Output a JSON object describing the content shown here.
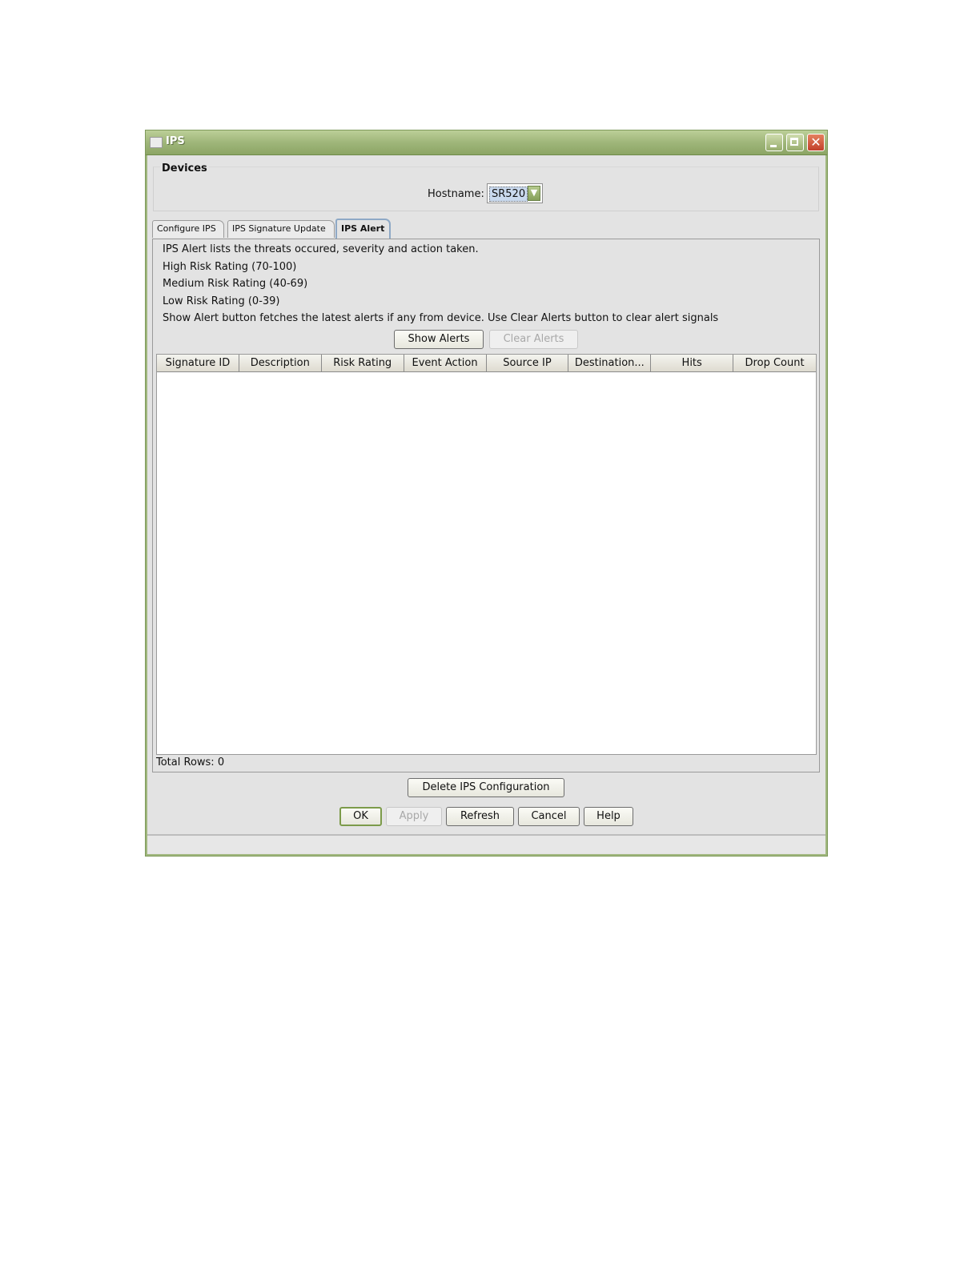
{
  "window": {
    "title": "IPS"
  },
  "devices": {
    "legend": "Devices",
    "hostname_label": "Hostname:",
    "hostname_value": "SR520"
  },
  "tabs": [
    {
      "label": "Configure IPS",
      "active": false
    },
    {
      "label": "IPS Signature Update",
      "active": false
    },
    {
      "label": "IPS Alert",
      "active": true
    }
  ],
  "alert": {
    "info_lines": [
      "IPS Alert lists the threats occured, severity and action taken.",
      "High Risk Rating (70-100)",
      "Medium Risk Rating (40-69)",
      "Low Risk Rating (0-39)",
      "Show Alert button fetches the latest alerts if any from device. Use Clear Alerts button to clear alert signals"
    ],
    "show_alerts_label": "Show Alerts",
    "clear_alerts_label": "Clear Alerts",
    "columns": [
      "Signature ID",
      "Description",
      "Risk Rating",
      "Event Action",
      "Source IP",
      "Destination...",
      "Hits",
      "Drop Count"
    ],
    "rows": [],
    "total_rows": "Total Rows: 0"
  },
  "buttons": {
    "delete_config": "Delete IPS Configuration",
    "ok": "OK",
    "apply": "Apply",
    "refresh": "Refresh",
    "cancel": "Cancel",
    "help": "Help"
  },
  "icons": {
    "window": "window-icon",
    "minimize": "minimize-icon",
    "maximize": "maximize-icon",
    "close": "close-icon",
    "dropdown": "chevron-down-icon"
  },
  "colors": {
    "titlebar": "#9fb67a",
    "accent_border": "#7c9b4a",
    "close_button": "#c2402a",
    "active_tab_border": "#8ea9c6"
  }
}
